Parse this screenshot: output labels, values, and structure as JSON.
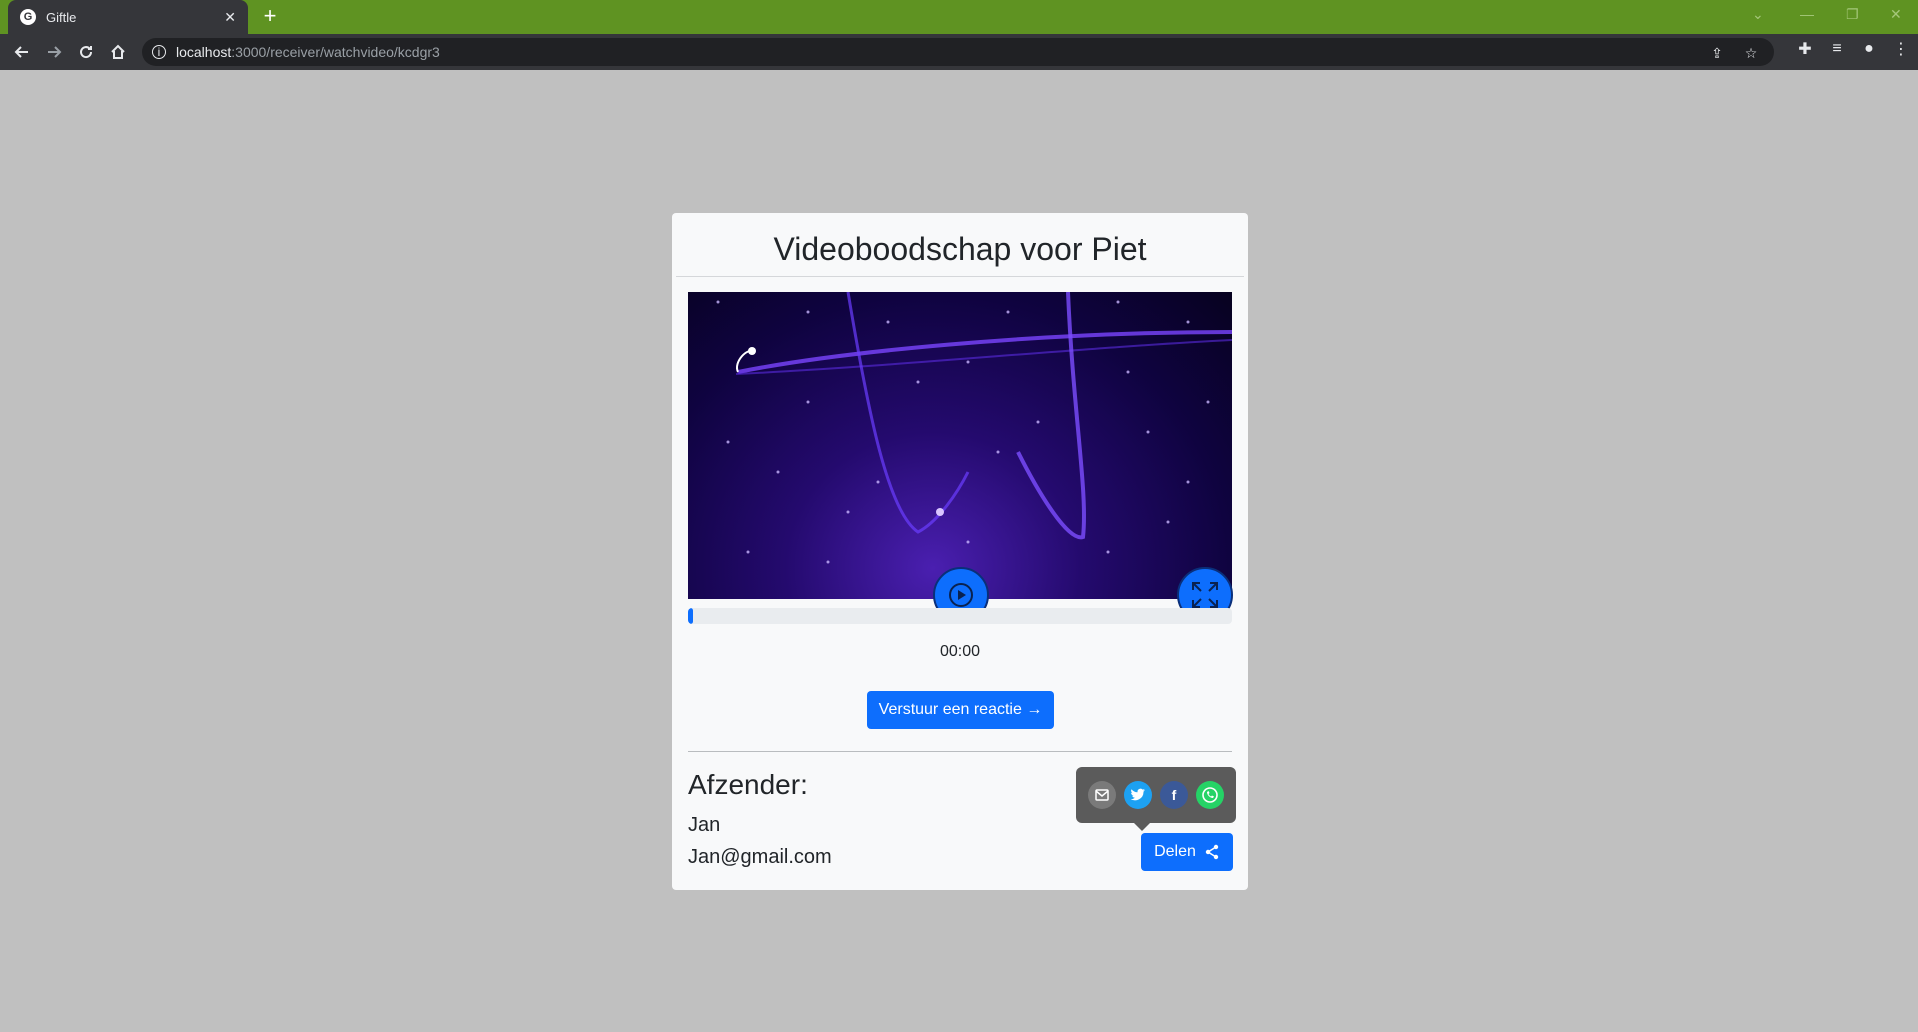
{
  "browser": {
    "tab_title": "Giftle",
    "url_host": "localhost",
    "url_path": ":3000/receiver/watchvideo/kcdgr3"
  },
  "page": {
    "title": "Videoboodschap voor Piet",
    "video": {
      "current_time": "00:00",
      "progress": 0.01
    },
    "reply_button": "Verstuur een reactie →",
    "sender": {
      "heading": "Afzender:",
      "name": "Jan",
      "email": "Jan@gmail.com"
    },
    "share": {
      "button_label": "Delen",
      "options": [
        "email",
        "twitter",
        "facebook",
        "whatsapp"
      ],
      "colors": {
        "email": "#7a7a7a",
        "twitter": "#1da1f2",
        "facebook": "#3b5998",
        "whatsapp": "#25d366"
      }
    }
  },
  "colors": {
    "accent": "#0d6efd",
    "tabbar": "#5f9322",
    "background": "#c0c0c0"
  }
}
